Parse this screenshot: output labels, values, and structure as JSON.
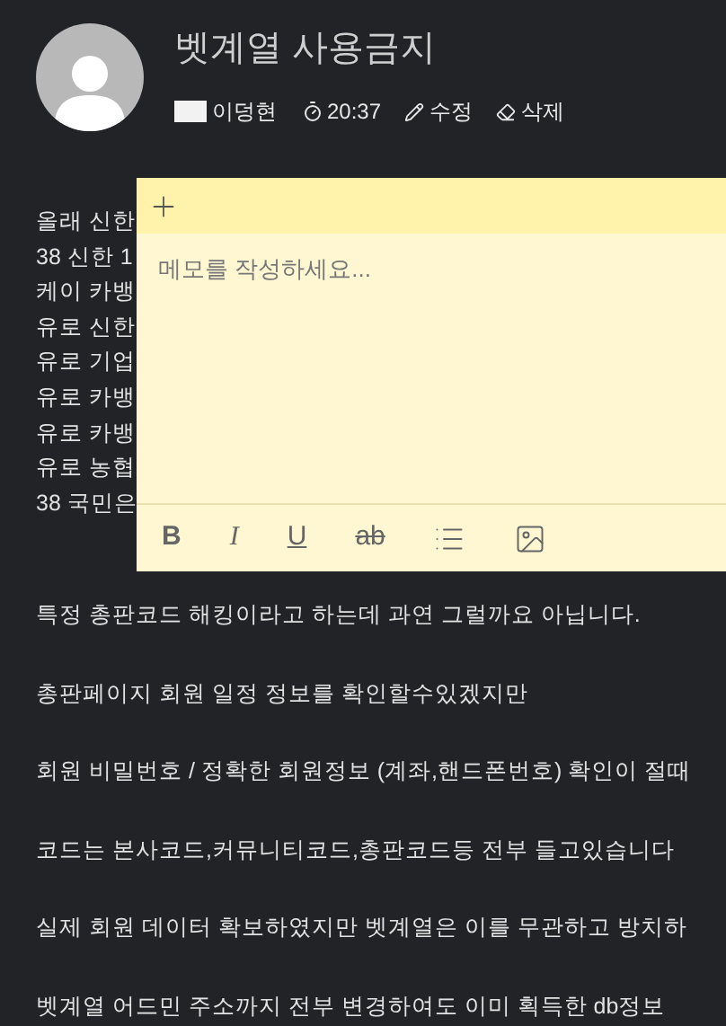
{
  "post": {
    "title": "벳계열 사용금지",
    "author": "이덩현",
    "time": "20:37",
    "actions": [
      "수정",
      "삭제"
    ]
  },
  "body_lines_partial": [
    "올래 신한",
    "38 신한 1",
    "케이 카뱅",
    "유로 신한",
    "유로 기업",
    "유로 카뱅",
    "유로 카뱅",
    "유로 농협",
    "38 국민은"
  ],
  "paragraphs": [
    "특정 총판코드 해킹이라고 하는데 과연 그럴까요 아닙니다.",
    "총판페이지 회원 일정 정보를 확인할수있겠지만",
    "회원 비밀번호 / 정확한 회원정보 (계좌,핸드폰번호) 확인이 절때",
    "코드는 본사코드,커뮤니티코드,총판코드등 전부 들고있습니다",
    "실제 회원 데이터 확보하였지만 벳계열은 이를 무관하고 방치하",
    "벳계열 어드민 주소까지 전부 변경하여도 이미 획득한 db정보"
  ],
  "memo": {
    "placeholder": "메모를 작성하세요...",
    "format_buttons": [
      "B",
      "I",
      "U",
      "ab"
    ]
  }
}
